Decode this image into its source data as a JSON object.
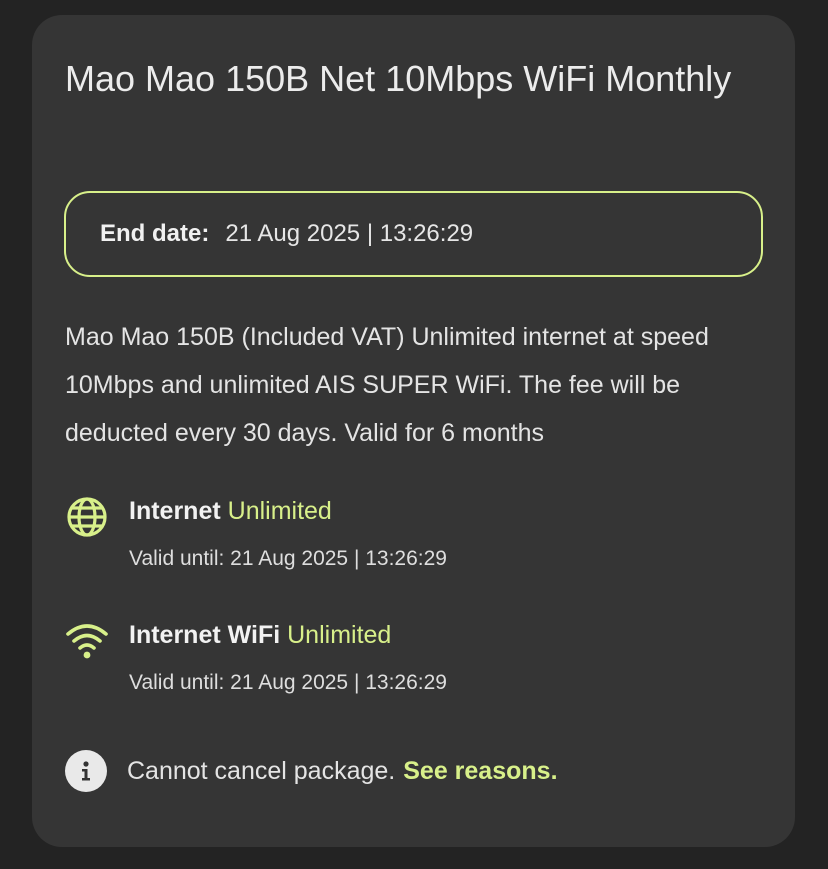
{
  "package": {
    "title": "Mao Mao 150B Net 10Mbps WiFi Monthly",
    "end_date_label": "End date:",
    "end_date_value": "21 Aug 2025 | 13:26:29",
    "description": "Mao Mao 150B (Included VAT) Unlimited internet at speed 10Mbps and unlimited AIS SUPER WiFi. The fee will be deducted every 30 days. Valid for 6 months"
  },
  "benefits": [
    {
      "icon": "globe-icon",
      "name": "Internet",
      "amount": "Unlimited",
      "valid_until": "Valid until: 21 Aug 2025 | 13:26:29"
    },
    {
      "icon": "wifi-icon",
      "name": "Internet WiFi",
      "amount": "Unlimited",
      "valid_until": "Valid until: 21 Aug 2025 | 13:26:29"
    }
  ],
  "notice": {
    "icon": "info-icon",
    "text": "Cannot cancel package.",
    "link": "See reasons."
  },
  "colors": {
    "background": "#232323",
    "card": "#353535",
    "accent": "#d8f08a",
    "text": "#e4e4e4"
  }
}
